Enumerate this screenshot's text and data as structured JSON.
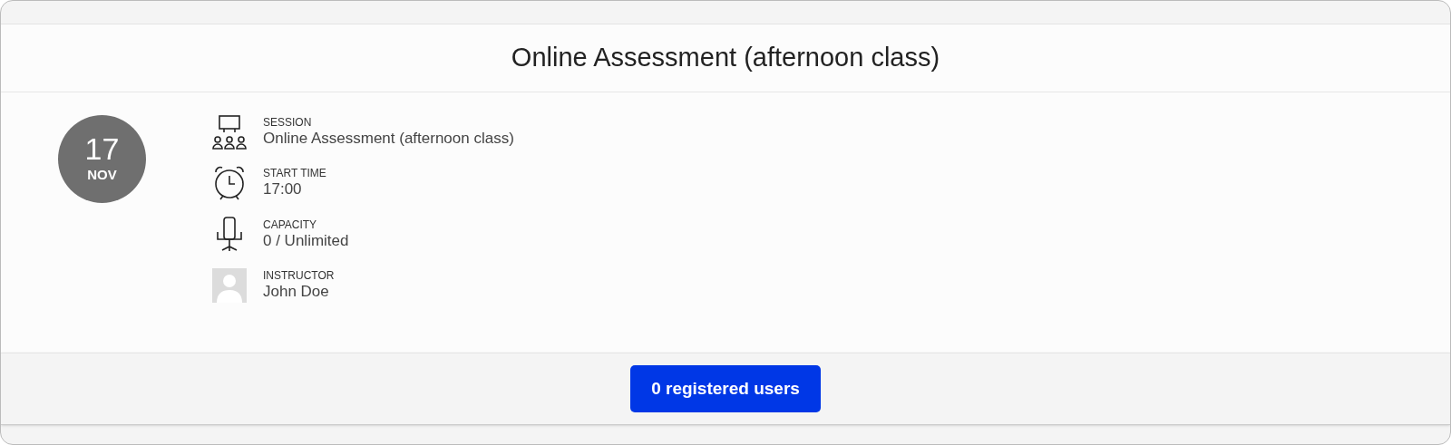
{
  "title": "Online Assessment (afternoon class)",
  "date": {
    "day": "17",
    "month": "NOV"
  },
  "details": [
    {
      "kind": "session",
      "label": "SESSION",
      "value": "Online Assessment (afternoon class)"
    },
    {
      "kind": "time",
      "label": "START TIME",
      "value": "17:00"
    },
    {
      "kind": "capacity",
      "label": "CAPACITY",
      "value": "0 / Unlimited"
    },
    {
      "kind": "instructor",
      "label": "INSTRUCTOR",
      "value": "John Doe"
    }
  ],
  "button": "0 registered users"
}
